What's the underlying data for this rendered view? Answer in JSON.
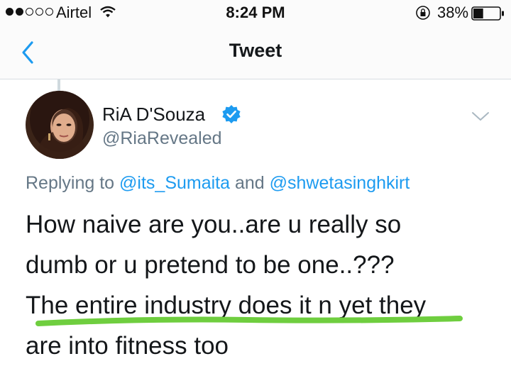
{
  "status_bar": {
    "signal_bars_filled": 2,
    "signal_bars_total": 5,
    "carrier": "Airtel",
    "time": "8:24 PM",
    "battery": "38%"
  },
  "nav": {
    "title": "Tweet",
    "back_icon": "chevron-left-icon"
  },
  "tweet": {
    "author": {
      "display_name": "RiA D'Souza",
      "username": "@RiaRevealed",
      "verified": true
    },
    "replying": {
      "prefix": "Replying to ",
      "mention_1": "@its_Sumaita",
      "conjunction": " and ",
      "mention_2": "@shwetasinghkirt"
    },
    "text_lines": [
      "How naive are you..are u really so",
      "dumb or u pretend to be one..???",
      "The entire industry does it n yet they",
      "are into fitness too"
    ]
  },
  "colors": {
    "link": "#1d9bf0",
    "secondary_text": "#657786",
    "verified": "#1d9bf0",
    "highlight_marker": "#6fce3f"
  }
}
